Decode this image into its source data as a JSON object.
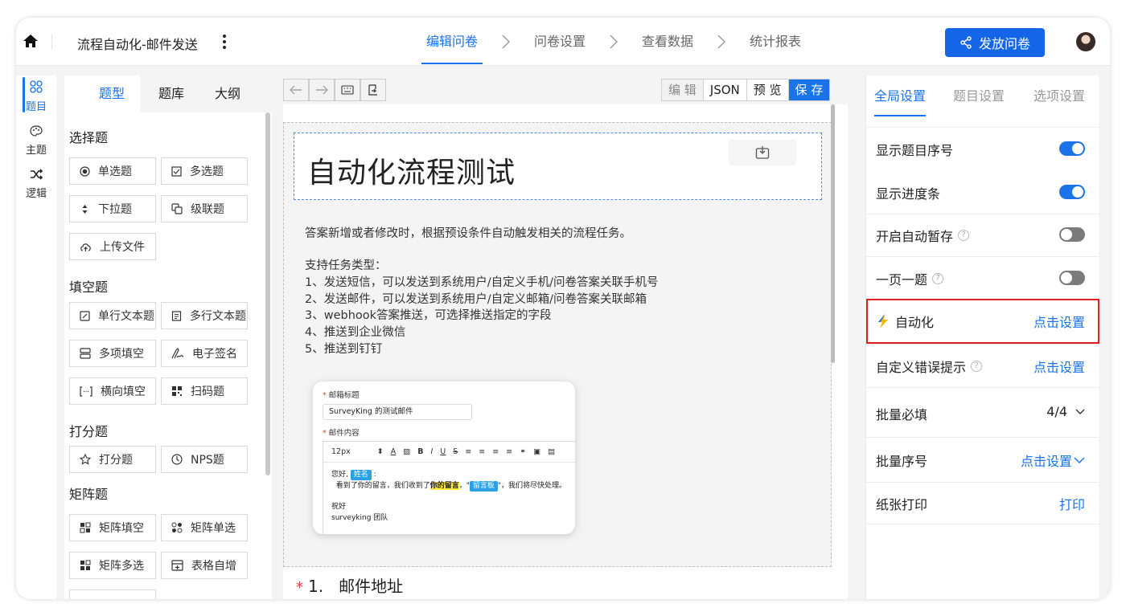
{
  "header": {
    "survey_title": "流程自动化-邮件发送",
    "steps": [
      "编辑问卷",
      "问卷设置",
      "查看数据",
      "统计报表"
    ],
    "publish_label": "发放问卷"
  },
  "leftnav": {
    "items": [
      {
        "label": "题目",
        "icon": "question-grid-icon"
      },
      {
        "label": "主题",
        "icon": "palette-icon"
      },
      {
        "label": "逻辑",
        "icon": "shuffle-icon"
      }
    ]
  },
  "widget_panel": {
    "tabs": [
      "题型",
      "题库",
      "大纲"
    ],
    "sections": [
      {
        "title": "选择题",
        "items": [
          "单选题",
          "多选题",
          "下拉题",
          "级联题",
          "上传文件"
        ]
      },
      {
        "title": "填空题",
        "items": [
          "单行文本题",
          "多行文本题",
          "多项填空",
          "电子签名",
          "横向填空",
          "扫码题"
        ]
      },
      {
        "title": "打分题",
        "items": [
          "打分题",
          "NPS题"
        ]
      },
      {
        "title": "矩阵题",
        "items": [
          "矩阵填空",
          "矩阵单选",
          "矩阵多选",
          "表格自增"
        ]
      }
    ]
  },
  "canvas": {
    "modes": [
      "编 辑",
      "JSON",
      "预 览",
      "保 存"
    ],
    "heading": "自动化流程测试",
    "desc_lines": [
      "答案新增或者修改时，根据预设条件自动触发相关的流程任务。",
      "支持任务类型：",
      "1、发送短信，可以发送到系统用户/自定义手机/问卷答案关联手机号",
      "2、发送邮件，可以发送到系统用户/自定义邮箱/问卷答案关联邮箱",
      "3、webhook答案推送，可选择推送指定的字段",
      "4、推送到企业微信",
      "5、推送到钉钉"
    ],
    "email_card": {
      "subject_label": "邮箱标题",
      "subject_value": "SurveyKing 的测试邮件",
      "content_label": "邮件内容",
      "font_size": "12px",
      "greeting": "您好,",
      "name_tag": "姓名",
      "line2_prefix": "看到了你的留言，我们收到了",
      "line2_highlight": "你的留言",
      "line2_mid": "，\"",
      "board_tag": "留言板",
      "line2_suffix": "\"，我们将尽快处理。",
      "closing": "祝好",
      "signature": "surveyking 团队"
    },
    "q1_number": "1.",
    "q1_title": "邮件地址"
  },
  "right_panel": {
    "tabs": [
      "全局设置",
      "题目设置",
      "选项设置"
    ],
    "rows": {
      "show_number": {
        "label": "显示题目序号",
        "toggle": true
      },
      "show_progress": {
        "label": "显示进度条",
        "toggle": true
      },
      "auto_save": {
        "label": "开启自动暂存",
        "toggle": false
      },
      "one_page": {
        "label": "一页一题",
        "toggle": false
      },
      "automation": {
        "label": "自动化",
        "action": "点击设置"
      },
      "custom_error": {
        "label": "自定义错误提示",
        "action": "点击设置"
      },
      "batch_required": {
        "label": "批量必填",
        "value": "4/4"
      },
      "batch_number": {
        "label": "批量序号",
        "action": "点击设置"
      },
      "print": {
        "label": "纸张打印",
        "action": "打印"
      }
    },
    "help_glyph": "?"
  },
  "colors": {
    "accent": "#1a73e8",
    "highlight_border": "#e02020",
    "publish": "#1565e8"
  }
}
